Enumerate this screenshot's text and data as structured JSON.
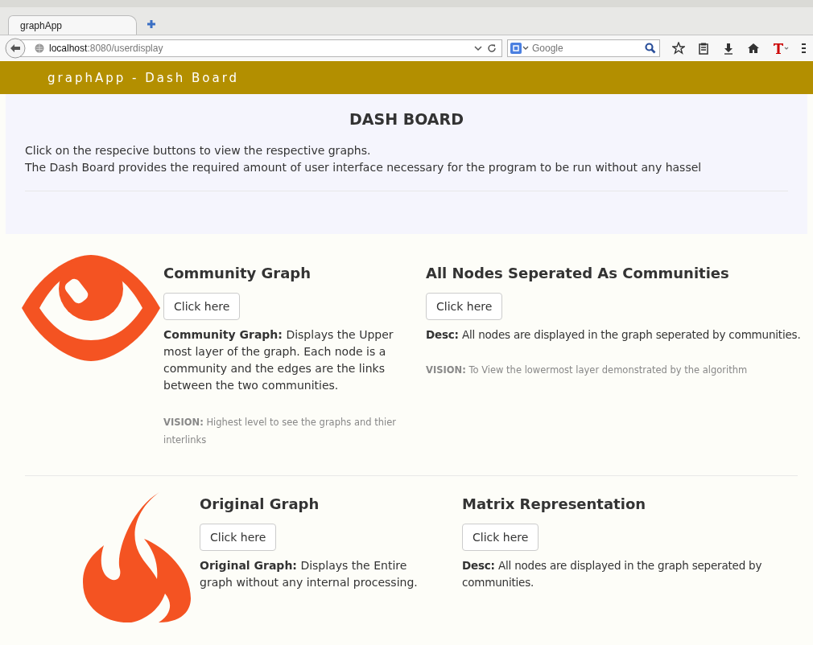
{
  "browser": {
    "tabs": [
      {
        "label": "graphApp",
        "selected": true
      }
    ],
    "url": {
      "host": "localhost",
      "path": ":8080/userdisplay"
    },
    "search": {
      "placeholder": "Google"
    }
  },
  "navbar": {
    "brand": "graphApp - Dash Board"
  },
  "intro": {
    "title": "DASH BOARD",
    "lines": [
      "Click on the respecive buttons to view the respective graphs.",
      "The Dash Board provides the required amount of user interface necessary for the program to be run without any hassel"
    ]
  },
  "sections": [
    {
      "kind": "eye",
      "items": [
        {
          "title": "Community Graph",
          "button": "Click here",
          "desc": "**Community Graph:** Displays the Upper most layer of the graph. Each node is a community and the edges are the links between the two communities.",
          "vision": "**VISION:** Highest level to see the graphs and thier interlinks"
        },
        {
          "title": "All Nodes Seperated As Communities",
          "button": "Click here",
          "desc": "**Desc:** All nodes are displayed in the graph seperated by communities.",
          "vision": "**VISION:** To View the lowermost layer demonstrated by the algorithm"
        }
      ]
    },
    {
      "kind": "flame",
      "items": [
        {
          "title": "Original Graph",
          "button": "Click here",
          "desc": "**Original Graph:** Displays the Entire graph without any internal processing."
        },
        {
          "title": "Matrix Representation",
          "button": "Click here",
          "desc": "**Desc:** All nodes are displayed in the graph seperated by communities."
        }
      ]
    }
  ]
}
